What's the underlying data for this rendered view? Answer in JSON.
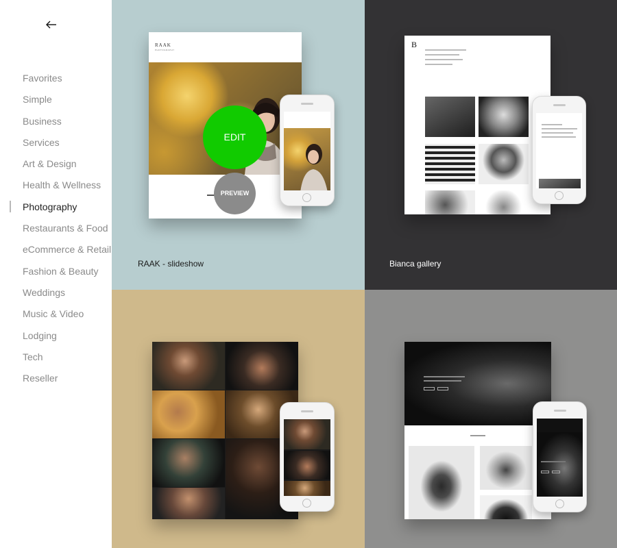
{
  "sidebar": {
    "back_label": "Back",
    "categories": [
      {
        "label": "Favorites"
      },
      {
        "label": "Simple"
      },
      {
        "label": "Business"
      },
      {
        "label": "Services"
      },
      {
        "label": "Art & Design"
      },
      {
        "label": "Health & Wellness"
      },
      {
        "label": "Photography",
        "active": true
      },
      {
        "label": "Restaurants & Food"
      },
      {
        "label": "eCommerce & Retail"
      },
      {
        "label": "Fashion & Beauty"
      },
      {
        "label": "Weddings"
      },
      {
        "label": "Music & Video"
      },
      {
        "label": "Lodging"
      },
      {
        "label": "Tech"
      },
      {
        "label": "Reseller"
      }
    ]
  },
  "templates": [
    {
      "name": "RAAK - slideshow",
      "background": "#b7cdcf",
      "logo": "RAAK",
      "logo_sub": "PHOTOGRAPHY"
    },
    {
      "name": "Bianca gallery",
      "background": "#333234",
      "logo": "B"
    },
    {
      "name": "",
      "background": "#cfb98b"
    },
    {
      "name": "",
      "background": "#8f8f8e"
    }
  ],
  "actions": {
    "edit_label": "EDIT",
    "preview_label": "PREVIEW"
  },
  "colors": {
    "edit": "#11cb00",
    "preview": "#8b8b8b",
    "active_category": "#222222",
    "category": "#8a8a8a"
  }
}
